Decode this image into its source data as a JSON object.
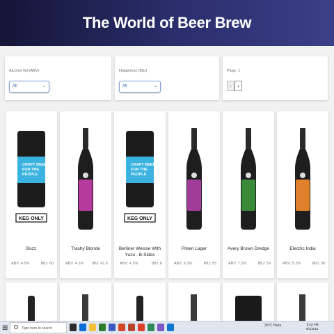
{
  "header": {
    "title": "The World of Beer Brew"
  },
  "filters": {
    "alcohol": {
      "label": "Alcohol Vol (ABV)",
      "value": "All"
    },
    "hoppiness": {
      "label": "Hoppiness (IBU)",
      "value": "All"
    },
    "page": {
      "label": "Page: 1",
      "prev": "‹",
      "next": "›"
    }
  },
  "beers": [
    {
      "name": "Buzz",
      "abv": "ABV: 4.5%",
      "ibu": "IBU: 60",
      "kind": "keg",
      "label_color": "#3ab3e0"
    },
    {
      "name": "Trashy Blonde",
      "abv": "ABV: 4.1%",
      "ibu": "IBU: 41.5",
      "kind": "bottle",
      "label_color": "#b43a9c"
    },
    {
      "name": "Berliner Weisse With Yuzu - B-Sides",
      "abv": "ABV: 4.2%",
      "ibu": "IBU: 8",
      "kind": "keg",
      "label_color": "#3ab3e0"
    },
    {
      "name": "Pilsen Lager",
      "abv": "ABV: 6.3%",
      "ibu": "IBU: 55",
      "kind": "bottle",
      "label_color": "#a03c9a"
    },
    {
      "name": "Avery Brown Dredge",
      "abv": "ABV: 7.2%",
      "ibu": "IBU: 59",
      "kind": "bottle",
      "label_color": "#3a8a3a"
    },
    {
      "name": "Electric India",
      "abv": "ABV: 5.2%",
      "ibu": "IBU: 38",
      "kind": "bottle",
      "label_color": "#e0802a"
    }
  ],
  "keg_badge": "KEG ONLY",
  "taskbar": {
    "search_placeholder": "Type here to search",
    "tray": "30°C Haze",
    "time": "5:03 PM",
    "date": "6/1/2021"
  }
}
